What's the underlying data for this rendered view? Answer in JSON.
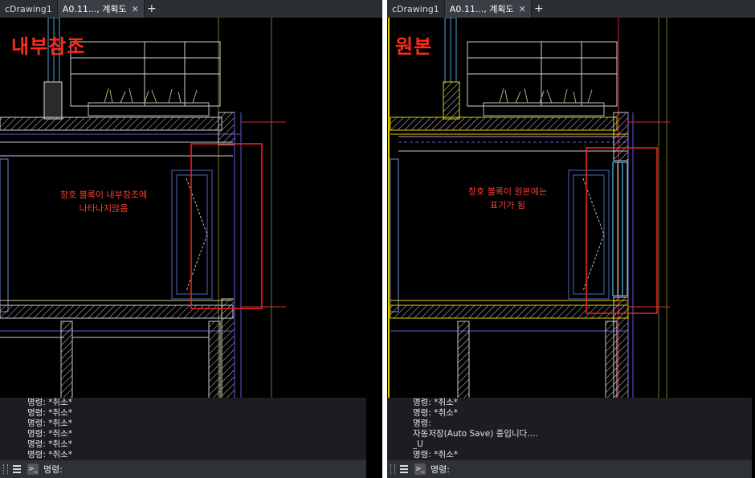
{
  "left": {
    "tabs": [
      {
        "label": "cDrawing1",
        "active": false
      },
      {
        "label": "A0.11..., 계획도",
        "active": true
      }
    ],
    "heading": "내부참조",
    "note_lines": [
      "창호 블록이 내부참조에",
      "나타나지않음"
    ],
    "command_history": [
      "명령: *취소*",
      "명령: *취소*",
      "명령: *취소*",
      "명령: *취소*",
      "명령: *취소*",
      "명령: *취소*"
    ],
    "command_prompt": "명령:"
  },
  "right": {
    "tabs": [
      {
        "label": "cDrawing1",
        "active": false
      },
      {
        "label": "A0.11..., 계획도",
        "active": true
      }
    ],
    "heading": "원본",
    "note_lines": [
      "창호 블록이 원본에는",
      "표기가 됨"
    ],
    "command_history": [
      "명령: *취소*",
      "명령: *취소*",
      "명령:",
      "자동저장(Auto Save) 중입니다....",
      "_U",
      "명령: *취소*"
    ],
    "command_prompt": "명령:"
  },
  "colors": {
    "highlight_box": "#ff2020",
    "annotation_text": "#ff3b30",
    "tab_bg": "#2b2e33",
    "canvas_bg": "#000000"
  },
  "icons": [
    "close-icon",
    "plus-icon",
    "menu-icon",
    "command-prompt-icon"
  ]
}
